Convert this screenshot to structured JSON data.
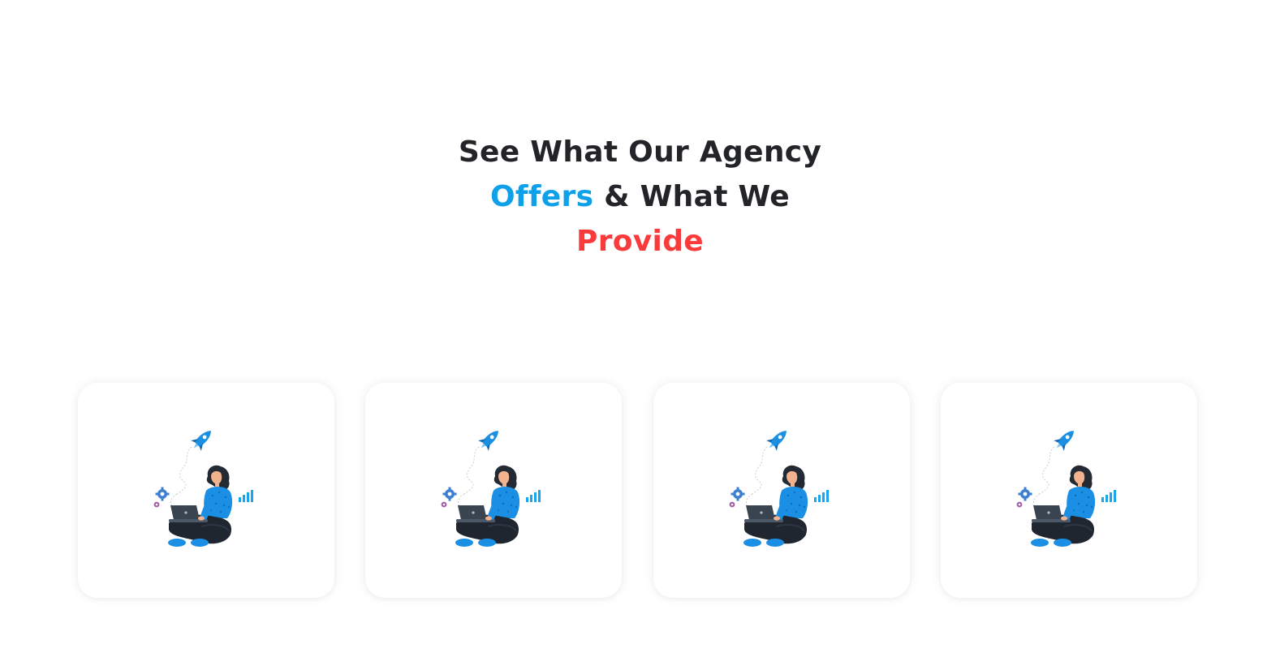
{
  "heading": {
    "part1": "See What Our Agency",
    "highlight_blue": "Offers",
    "part2": " & What We",
    "highlight_red": "Provide"
  },
  "colors": {
    "text": "#222428",
    "accent_blue": "#0ea1ea",
    "accent_red": "#fb3b3b",
    "card_bg": "#ffffff"
  },
  "cards": [
    {
      "illustration": "woman-with-laptop-rocket-illustration"
    },
    {
      "illustration": "woman-with-laptop-rocket-illustration"
    },
    {
      "illustration": "woman-with-laptop-rocket-illustration"
    },
    {
      "illustration": "woman-with-laptop-rocket-illustration"
    }
  ]
}
